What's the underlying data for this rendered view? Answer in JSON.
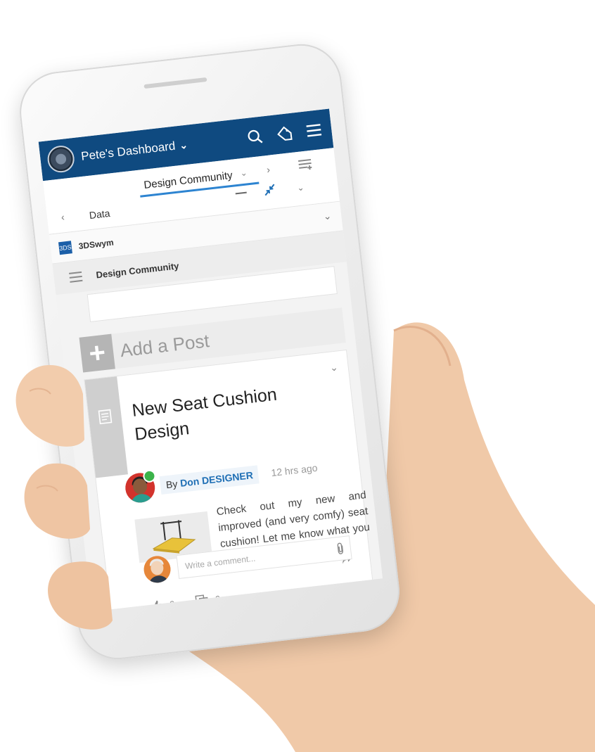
{
  "header": {
    "dashboard_title": "Pete's Dashboard"
  },
  "tabs": {
    "active": "Design Community",
    "other": "Data"
  },
  "widget": {
    "app_name": "3DSwym",
    "logo_text": "3DS"
  },
  "community": {
    "name": "Design Community",
    "add_post_label": "Add a Post"
  },
  "post": {
    "title": "New Seat Cushion Design",
    "by_prefix": "By",
    "author": "Don DESIGNER",
    "time": "12 hrs ago",
    "body": "Check out my new and improved (and very comfy) seat cushion! Let me know what you think.",
    "likes": "0",
    "comments": "0"
  },
  "comment": {
    "placeholder": "Write a comment..."
  },
  "colors": {
    "topbar": "#0f4a80",
    "accent": "#2d84d1",
    "author_link": "#1f6fb5"
  }
}
